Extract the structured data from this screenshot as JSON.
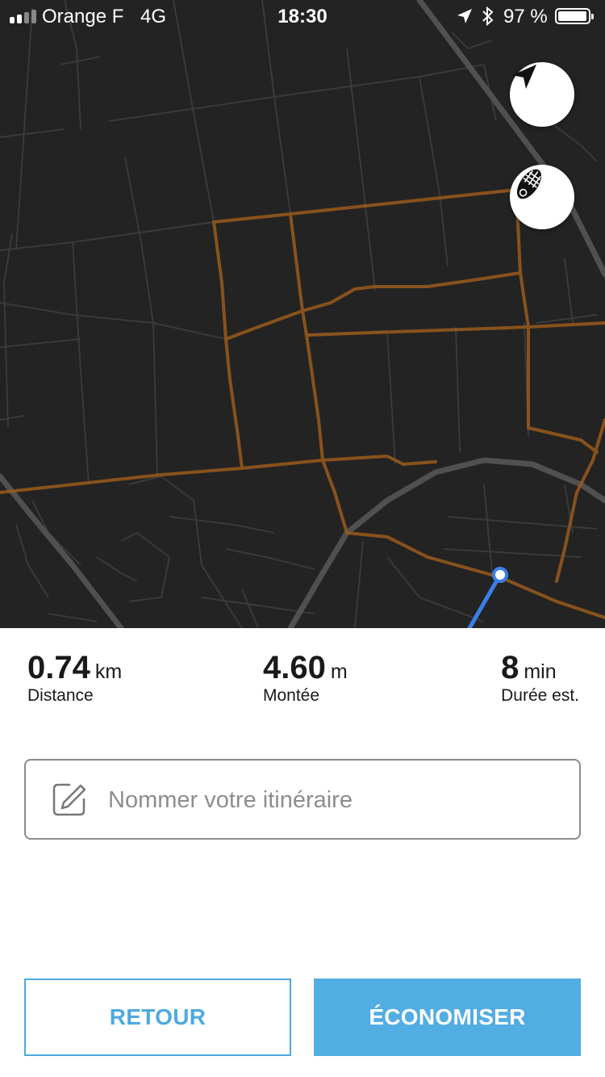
{
  "status_bar": {
    "carrier": "Orange F",
    "network": "4G",
    "time": "18:30",
    "battery": "97 %",
    "icons": [
      "signal-icon",
      "location-arrow-icon",
      "bluetooth-icon",
      "battery-icon"
    ]
  },
  "map": {
    "buttons": [
      {
        "name": "locate-button",
        "icon": "navigation-arrow-icon"
      },
      {
        "name": "activity-type-button",
        "icon": "running-shoe-icon"
      }
    ],
    "colors": {
      "background": "#232323",
      "road": "#3b3b3b",
      "highway": "#555555",
      "heatmap": "#a8651e",
      "route": "#3b7ee8"
    }
  },
  "stats": {
    "distance": {
      "value": "0.74",
      "unit": "km",
      "label": "Distance"
    },
    "climb": {
      "value": "4.60",
      "unit": "m",
      "label": "Montée"
    },
    "duration": {
      "value": "8",
      "unit": "min",
      "label": "Durée est."
    }
  },
  "name_field": {
    "placeholder": "Nommer votre itinéraire",
    "icon": "edit-pencil-icon"
  },
  "actions": {
    "back_label": "RETOUR",
    "save_label": "ÉCONOMISER"
  },
  "colors": {
    "accent": "#52ade3"
  }
}
